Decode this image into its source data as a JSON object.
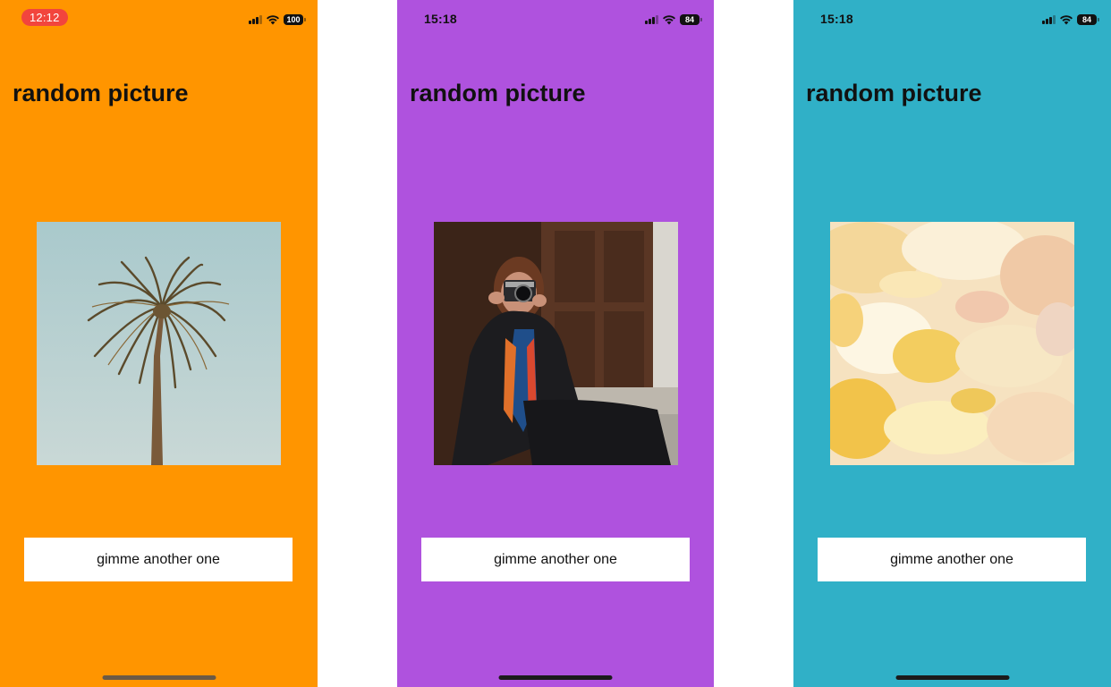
{
  "screens": [
    {
      "status": {
        "time": "12:12",
        "battery": "100"
      },
      "title": "random picture",
      "image_subject": "palm tree against blue sky",
      "button_label": "gimme another one",
      "background": "#ff9500"
    },
    {
      "status": {
        "time": "15:18",
        "battery": "84"
      },
      "title": "random picture",
      "image_subject": "woman with camera sitting by wooden door",
      "button_label": "gimme another one",
      "background": "#af52de"
    },
    {
      "status": {
        "time": "15:18",
        "battery": "84"
      },
      "title": "random picture",
      "image_subject": "abstract yellow paint strokes",
      "button_label": "gimme another one",
      "background": "#30b0c7"
    }
  ],
  "icons": {
    "signal": "cellular-signal-icon",
    "wifi": "wifi-icon",
    "battery": "battery-icon"
  }
}
